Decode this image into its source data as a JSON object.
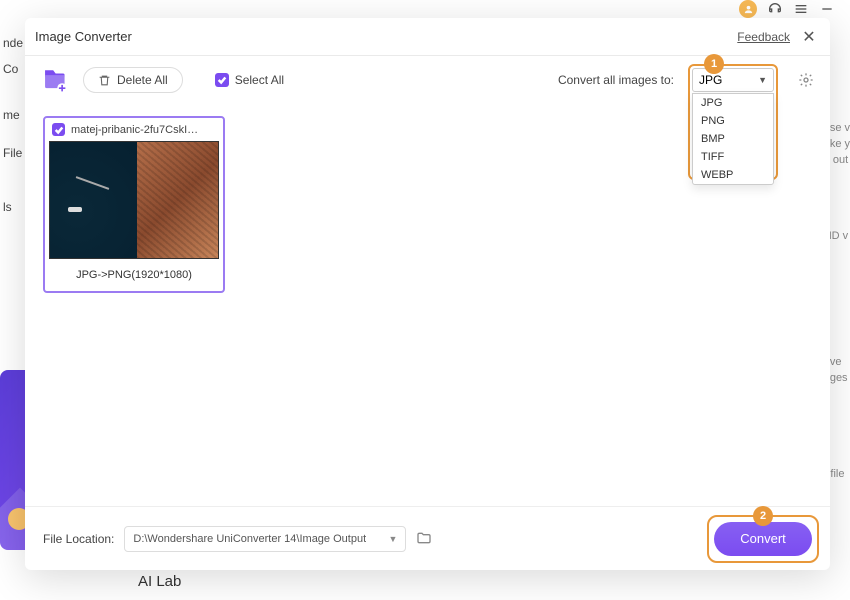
{
  "bg": {
    "sidebar": [
      "nde",
      "Co",
      "me",
      "File",
      "ls"
    ],
    "right_lines": [
      "use v",
      "ake y",
      "d out",
      "HD v",
      "nve",
      "ages",
      "r file"
    ],
    "ailab": "AI Lab"
  },
  "modal": {
    "title": "Image Converter",
    "feedback": "Feedback"
  },
  "toolbar": {
    "delete_all": "Delete All",
    "select_all": "Select All",
    "convert_label": "Convert all images to:",
    "format_selected": "JPG",
    "format_options": [
      "JPG",
      "PNG",
      "BMP",
      "TIFF",
      "WEBP"
    ]
  },
  "thumb": {
    "filename": "matej-pribanic-2fu7CskIT...",
    "caption": "JPG->PNG(1920*1080)"
  },
  "footer": {
    "label": "File Location:",
    "path": "D:\\Wondershare UniConverter 14\\Image Output",
    "convert": "Convert"
  },
  "callouts": {
    "one": "1",
    "two": "2"
  }
}
